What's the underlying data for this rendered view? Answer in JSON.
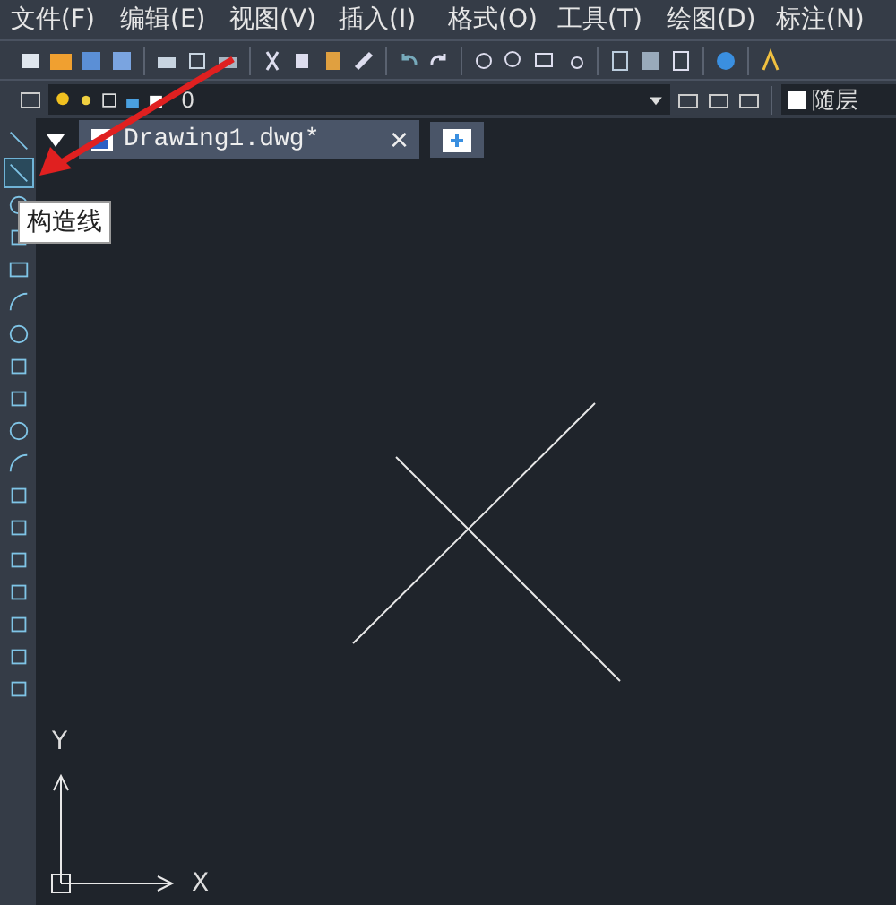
{
  "menu": [
    "文件(F)",
    "编辑(E)",
    "视图(V)",
    "插入(I)",
    "格式(O)",
    "工具(T)",
    "绘图(D)",
    "标注(N)"
  ],
  "layer_bar": {
    "layer": "0",
    "linetype": "随层"
  },
  "tabs": [
    {
      "label": "Drawing1.dwg*",
      "selected": true,
      "close": "×"
    }
  ],
  "tools": [
    {
      "selected": false
    },
    {
      "selected": true
    },
    {
      "selected": false
    },
    {
      "selected": false
    },
    {
      "selected": false
    },
    {
      "selected": false
    },
    {
      "selected": false
    },
    {
      "selected": false
    },
    {
      "selected": false
    },
    {
      "selected": false
    },
    {
      "selected": false
    },
    {
      "selected": false
    },
    {
      "selected": false
    },
    {
      "selected": false
    },
    {
      "selected": false
    },
    {
      "selected": false
    },
    {
      "selected": false
    },
    {
      "selected": false
    }
  ],
  "tooltip": "构造线",
  "ucs": {
    "x_label": "X",
    "y_label": "Y"
  }
}
